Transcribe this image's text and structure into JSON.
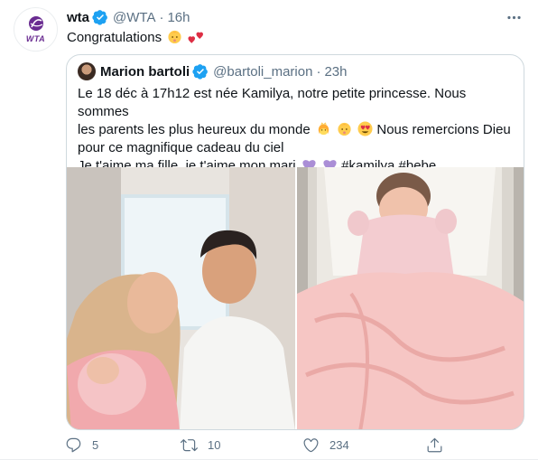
{
  "tweet": {
    "display_name": "wta",
    "handle": "@WTA",
    "separator": "·",
    "time": "16h",
    "text": "Congratulations",
    "avatar_text": "WTA"
  },
  "quoted": {
    "display_name": "Marion bartoli",
    "handle": "@bartoli_marion",
    "separator": "·",
    "time": "23h",
    "line1": "Le 18 déc à 17h12 est née Kamilya, notre petite princesse. Nous sommes",
    "line2a": "les parents les plus heureux du monde",
    "line2b": "Nous remercions Dieu",
    "line3": "pour ce magnifique cadeau du ciel",
    "line4a": "Je t'aime ma fille, je t'aime mon mari",
    "hashtag1": "#kamilya",
    "hashtag2": "#bebe"
  },
  "actions": {
    "reply_count": "5",
    "retweet_count": "10",
    "like_count": "234"
  },
  "colors": {
    "verified": "#1da1f2",
    "muted": "#5b7083",
    "wta_purple": "#6a2c91",
    "heart_purple": "#9b59d0",
    "pink_blanket": "#f6c6c4"
  },
  "icons": [
    "verified-badge",
    "more-icon",
    "baby-emoji",
    "hearts-emoji",
    "princess-emoji",
    "heart-eyes-emoji",
    "purple-heart-emoji",
    "reply-icon",
    "retweet-icon",
    "like-icon",
    "share-icon"
  ]
}
